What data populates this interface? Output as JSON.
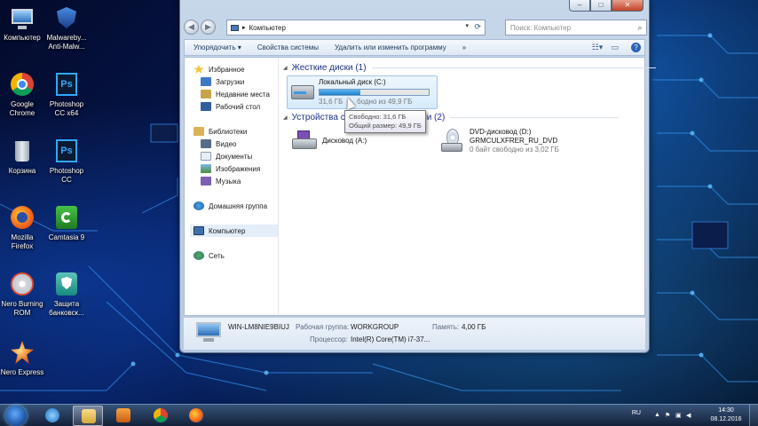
{
  "desktop": {
    "icons": [
      {
        "label": "Компьютер",
        "icon": "computer-icon"
      },
      {
        "label": "Malwareby...\nAnti-Malw...",
        "icon": "malwarebytes-icon"
      },
      {
        "label": "Google\nChrome",
        "icon": "chrome-icon"
      },
      {
        "label": "Photoshop\nCC x64",
        "icon": "photoshop-icon"
      },
      {
        "label": "Корзина",
        "icon": "recycle-bin-icon"
      },
      {
        "label": "Photoshop\nCC",
        "icon": "photoshop-icon"
      },
      {
        "label": "Mozilla\nFirefox",
        "icon": "firefox-icon"
      },
      {
        "label": "Camtasia 9",
        "icon": "camtasia-icon"
      },
      {
        "label": "Nero Burning\nROM",
        "icon": "nero-icon"
      },
      {
        "label": "Защита\nбанковск...",
        "icon": "bank-protection-icon"
      },
      {
        "label": "Nero Express",
        "icon": "nero-express-icon"
      }
    ]
  },
  "window": {
    "controls": {
      "minimize": "–",
      "maximize": "□",
      "close": "✕"
    },
    "address": {
      "path": "Компьютер",
      "separator": "▸"
    },
    "search": {
      "placeholder": "Поиск: Компьютер"
    },
    "toolbar": {
      "organize": "Упорядочить ▾",
      "system_properties": "Свойства системы",
      "uninstall": "Удалить или изменить программу",
      "more": "»"
    },
    "nav": {
      "favorites": "Избранное",
      "downloads": "Загрузки",
      "recent": "Недавние места",
      "desktop": "Рабочий стол",
      "libraries": "Библиотеки",
      "video": "Видео",
      "documents": "Документы",
      "images": "Изображения",
      "music": "Музыка",
      "homegroup": "Домашняя группа",
      "computer": "Компьютер",
      "network": "Сеть"
    },
    "groups": {
      "hard_drives": "Жесткие диски (1)",
      "removable": "Устройства со",
      "removable_tail": "ями (2)"
    },
    "drives": {
      "c": {
        "name": "Локальный диск (C:)",
        "free_label": "31,6 ГБ",
        "free_rest": "бодно из 49,9 ГБ",
        "used_fraction": 0.37
      },
      "a": {
        "name": "Дисковод (A:)"
      },
      "dvd": {
        "name": "DVD-дисковод (D:)",
        "label": "GRMCULXFRER_RU_DVD",
        "free": "0 байт свободно из 3,02 ГБ"
      }
    },
    "tooltip": {
      "free": "Свободно: 31,6 ГБ",
      "total": "Общий размер: 49,9 ГБ"
    },
    "details": {
      "computer_name": "WIN-LM8NIE9BIUJ",
      "workgroup_label": "Рабочая группа:",
      "workgroup_value": "WORKGROUP",
      "memory_label": "Память:",
      "memory_value": "4,00 ГБ",
      "cpu_label": "Процессор:",
      "cpu_value": "Intel(R) Core(TM) i7-37..."
    }
  },
  "taskbar": {
    "lang": "RU",
    "time": "14:30",
    "date": "08.12.2016"
  }
}
